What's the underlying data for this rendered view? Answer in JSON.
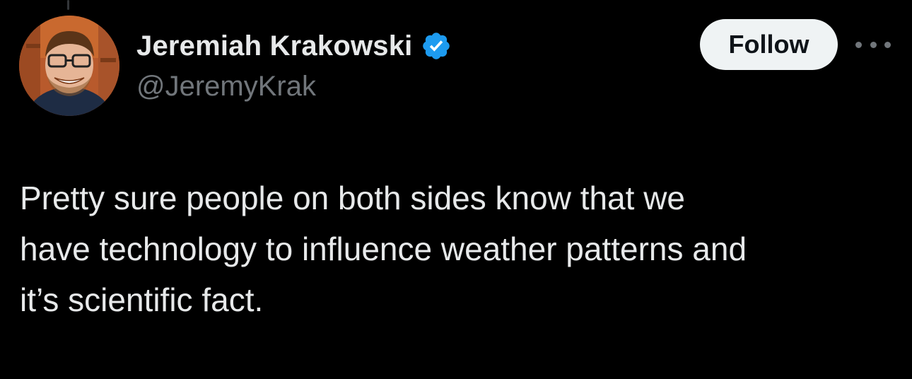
{
  "author": {
    "display_name": "Jeremiah Krakowski",
    "handle": "@JeremyKrak",
    "verified": true
  },
  "actions": {
    "follow_label": "Follow",
    "more_icon": "more-horizontal-icon"
  },
  "tweet": {
    "text": "Pretty sure people on both sides know that we\nhave technology to influence weather patterns and\nit’s scientific fact."
  },
  "colors": {
    "background": "#000000",
    "text_primary": "#e7e9ea",
    "text_secondary": "#71767b",
    "verified_blue": "#1d9bf0",
    "follow_button_bg": "#eff3f4",
    "follow_button_text": "#0f1419"
  }
}
